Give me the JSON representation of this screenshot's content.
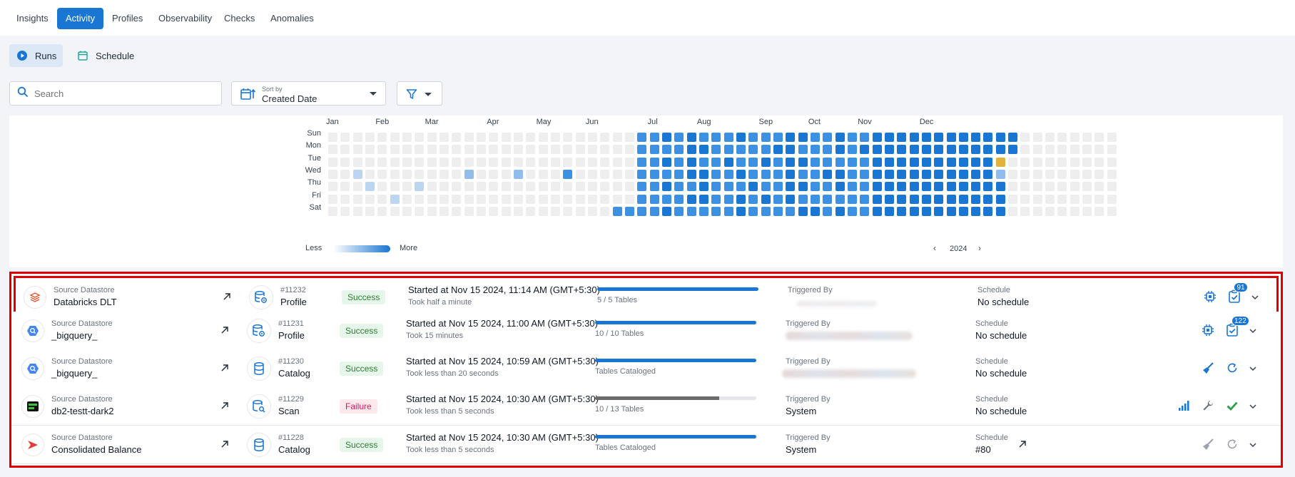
{
  "topnav": {
    "tabs": [
      {
        "label": "Insights",
        "active": false
      },
      {
        "label": "Activity",
        "active": true
      },
      {
        "label": "Profiles",
        "active": false
      },
      {
        "label": "Observability",
        "active": false
      },
      {
        "label": "Checks",
        "active": false
      },
      {
        "label": "Anomalies",
        "active": false
      }
    ]
  },
  "subtabs": {
    "runs": "Runs",
    "schedule": "Schedule"
  },
  "filters": {
    "search_placeholder": "Search",
    "sort_label": "Sort by",
    "sort_value": "Created Date"
  },
  "heatmap": {
    "months": [
      "Jan",
      "Feb",
      "Mar",
      "Apr",
      "May",
      "Jun",
      "Jul",
      "Aug",
      "Sep",
      "Oct",
      "Nov",
      "Dec"
    ],
    "days": [
      "Sun",
      "Mon",
      "Tue",
      "Wed",
      "Thu",
      "Fri",
      "Sat"
    ],
    "legend_less": "Less",
    "legend_more": "More",
    "year": "2024",
    "levels_by_week": [
      "0000000",
      "0000000",
      "0001000",
      "0000100",
      "0000000",
      "0000010",
      "0000000",
      "0000100",
      "0000000",
      "0000000",
      "0000000",
      "0002000",
      "0000000",
      "0000000",
      "0000000",
      "0002000",
      "0000000",
      "0000000",
      "0000000",
      "0003000",
      "0000000",
      "0000000",
      "0000000",
      "0000003",
      "0000003",
      "3333333",
      "3333333",
      "4343434",
      "3333333",
      "4444343",
      "3434443",
      "3333333",
      "3343333",
      "4334344",
      "3333433",
      "3343343",
      "3433333",
      "4444443",
      "4343434",
      "3333334",
      "3334333",
      "4434434",
      "3333333",
      "3433333",
      "4444444",
      "4444444",
      "4444444",
      "4444444",
      "4444444",
      "4444444",
      "4444444",
      "4444444",
      "4444444",
      "4444444",
      "4452444",
      "4400000",
      "0000000",
      "0000000",
      "0000000",
      "0000000",
      "0000000",
      "0000000",
      "0000000",
      "0000000"
    ]
  },
  "runs": [
    {
      "logo": "databricks-logo",
      "datastore_label": "Source Datastore",
      "datastore_name": "Databricks DLT",
      "op_icon": "profile-icon",
      "op_id": "#11232",
      "op_name": "Profile",
      "status": "Success",
      "started": "Started at Nov 15 2024, 11:14 AM (GMT+5:30)",
      "took": "Took half a minute",
      "progress_fraction": 1.0,
      "progress_text": "5 / 5 Tables",
      "triggered_label": "Triggered By",
      "triggered_value": "",
      "schedule_label": "Schedule",
      "schedule_value": "No schedule",
      "badge": "91",
      "selected": true
    },
    {
      "logo": "bigquery-logo",
      "datastore_label": "Source Datastore",
      "datastore_name": "_bigquery_",
      "op_icon": "profile-icon",
      "op_id": "#11231",
      "op_name": "Profile",
      "status": "Success",
      "started": "Started at Nov 15 2024, 11:00 AM (GMT+5:30)",
      "took": "Took 15 minutes",
      "progress_fraction": 1.0,
      "progress_text": "10 / 10 Tables",
      "triggered_label": "Triggered By",
      "triggered_value": "",
      "schedule_label": "Schedule",
      "schedule_value": "No schedule",
      "badge": "122",
      "selected": false
    },
    {
      "logo": "bigquery-logo",
      "datastore_label": "Source Datastore",
      "datastore_name": "_bigquery_",
      "op_icon": "catalog-icon",
      "op_id": "#11230",
      "op_name": "Catalog",
      "status": "Success",
      "started": "Started at Nov 15 2024, 10:59 AM (GMT+5:30)",
      "took": "Took less than 20 seconds",
      "progress_fraction": 1.0,
      "progress_text": "Tables Cataloged",
      "triggered_label": "Triggered By",
      "triggered_value": "",
      "schedule_label": "Schedule",
      "schedule_value": "No schedule",
      "badge": "",
      "selected": false
    },
    {
      "logo": "db2-logo",
      "datastore_label": "Source Datastore",
      "datastore_name": "db2-testt-dark2",
      "op_icon": "scan-icon",
      "op_id": "#11229",
      "op_name": "Scan",
      "status": "Failure",
      "started": "Started at Nov 15 2024, 10:30 AM (GMT+5:30)",
      "took": "Took less than 5 seconds",
      "progress_fraction": 0.77,
      "progress_text": "10 / 13 Tables",
      "triggered_label": "Triggered By",
      "triggered_value": "System",
      "schedule_label": "Schedule",
      "schedule_value": "No schedule",
      "badge": "",
      "selected": false
    },
    {
      "logo": "consolidated-logo",
      "datastore_label": "Source Datastore",
      "datastore_name": "Consolidated Balance",
      "op_icon": "catalog-icon",
      "op_id": "#11228",
      "op_name": "Catalog",
      "status": "Success",
      "started": "Started at Nov 15 2024, 10:30 AM (GMT+5:30)",
      "took": "Took less than 5 seconds",
      "progress_fraction": 1.0,
      "progress_text": "Tables Cataloged",
      "triggered_label": "Triggered By",
      "triggered_value": "System",
      "schedule_label": "Schedule",
      "schedule_value": "#80",
      "badge": "",
      "selected": false
    }
  ],
  "colors": {
    "accent": "#1976d2",
    "highlight": "#e00000",
    "success": "#2e7d32",
    "failure": "#d81b60"
  }
}
